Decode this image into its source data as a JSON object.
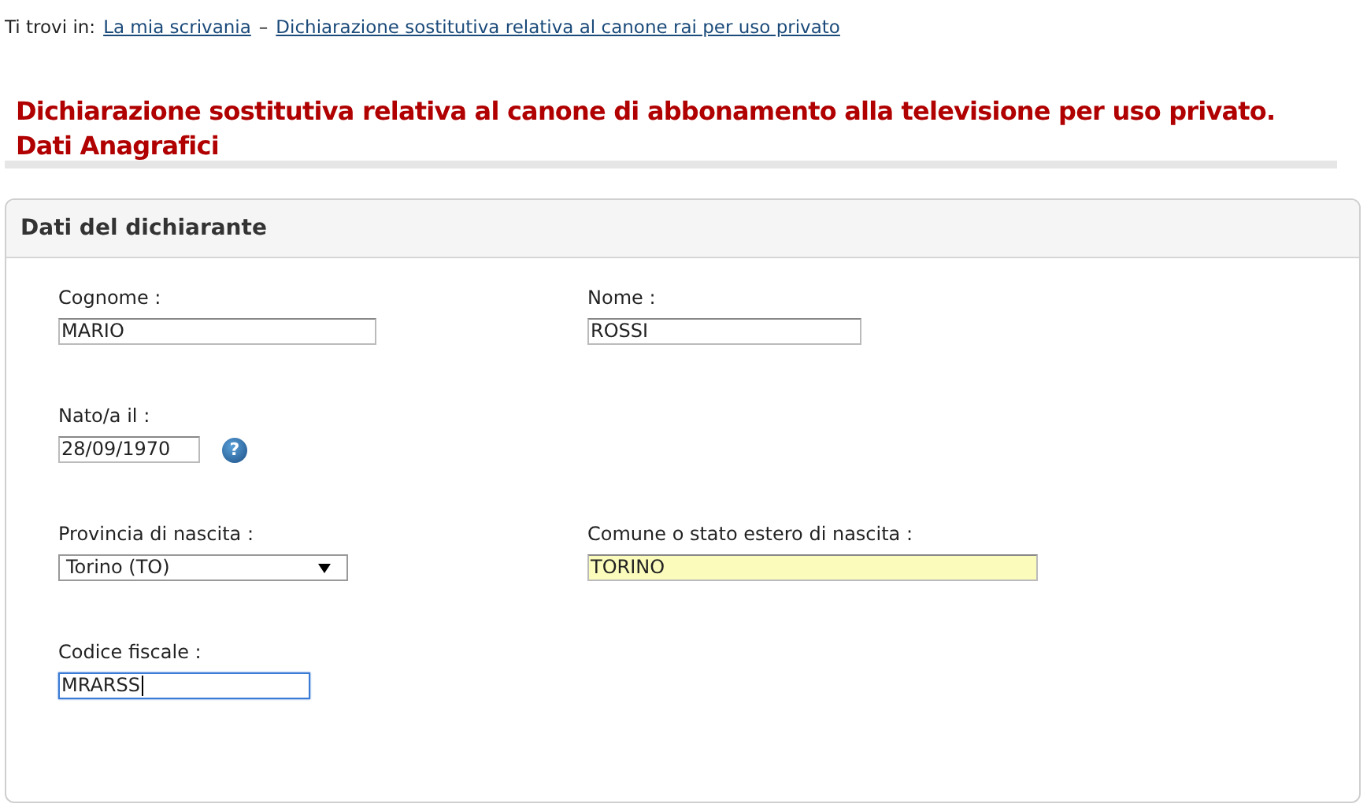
{
  "breadcrumb": {
    "prefix": "Ti trovi in:",
    "separator": "–",
    "links": [
      "La mia scrivania",
      "Dichiarazione sostitutiva relativa al canone rai per uso privato"
    ]
  },
  "title_lines": [
    "Dichiarazione sostitutiva relativa al canone di abbonamento alla televisione per uso privato.",
    "Dati Anagrafici"
  ],
  "panel": {
    "title": "Dati del dichiarante",
    "rows": [
      {
        "fields": [
          {
            "kind": "text",
            "label": "Cognome :",
            "value": "MARIO",
            "highlighted": false,
            "focused": false
          },
          {
            "kind": "text",
            "label": "Nome :",
            "value": "ROSSI",
            "highlighted": false,
            "focused": false
          }
        ]
      },
      {
        "fields": [
          {
            "kind": "date",
            "label": "Nato/a il :",
            "value": "28/09/1970",
            "help": "?",
            "highlighted": false,
            "focused": false
          }
        ]
      },
      {
        "fields": [
          {
            "kind": "select",
            "label": "Provincia di nascita :",
            "value": "Torino (TO)",
            "highlighted": false,
            "focused": false
          },
          {
            "kind": "text",
            "label": "Comune o stato estero di nascita :",
            "value": "TORINO",
            "highlighted": true,
            "focused": false
          }
        ]
      },
      {
        "fields": [
          {
            "kind": "text",
            "label": "Codice fiscale :",
            "value": "MRARSS",
            "highlighted": false,
            "focused": true
          }
        ]
      }
    ]
  }
}
